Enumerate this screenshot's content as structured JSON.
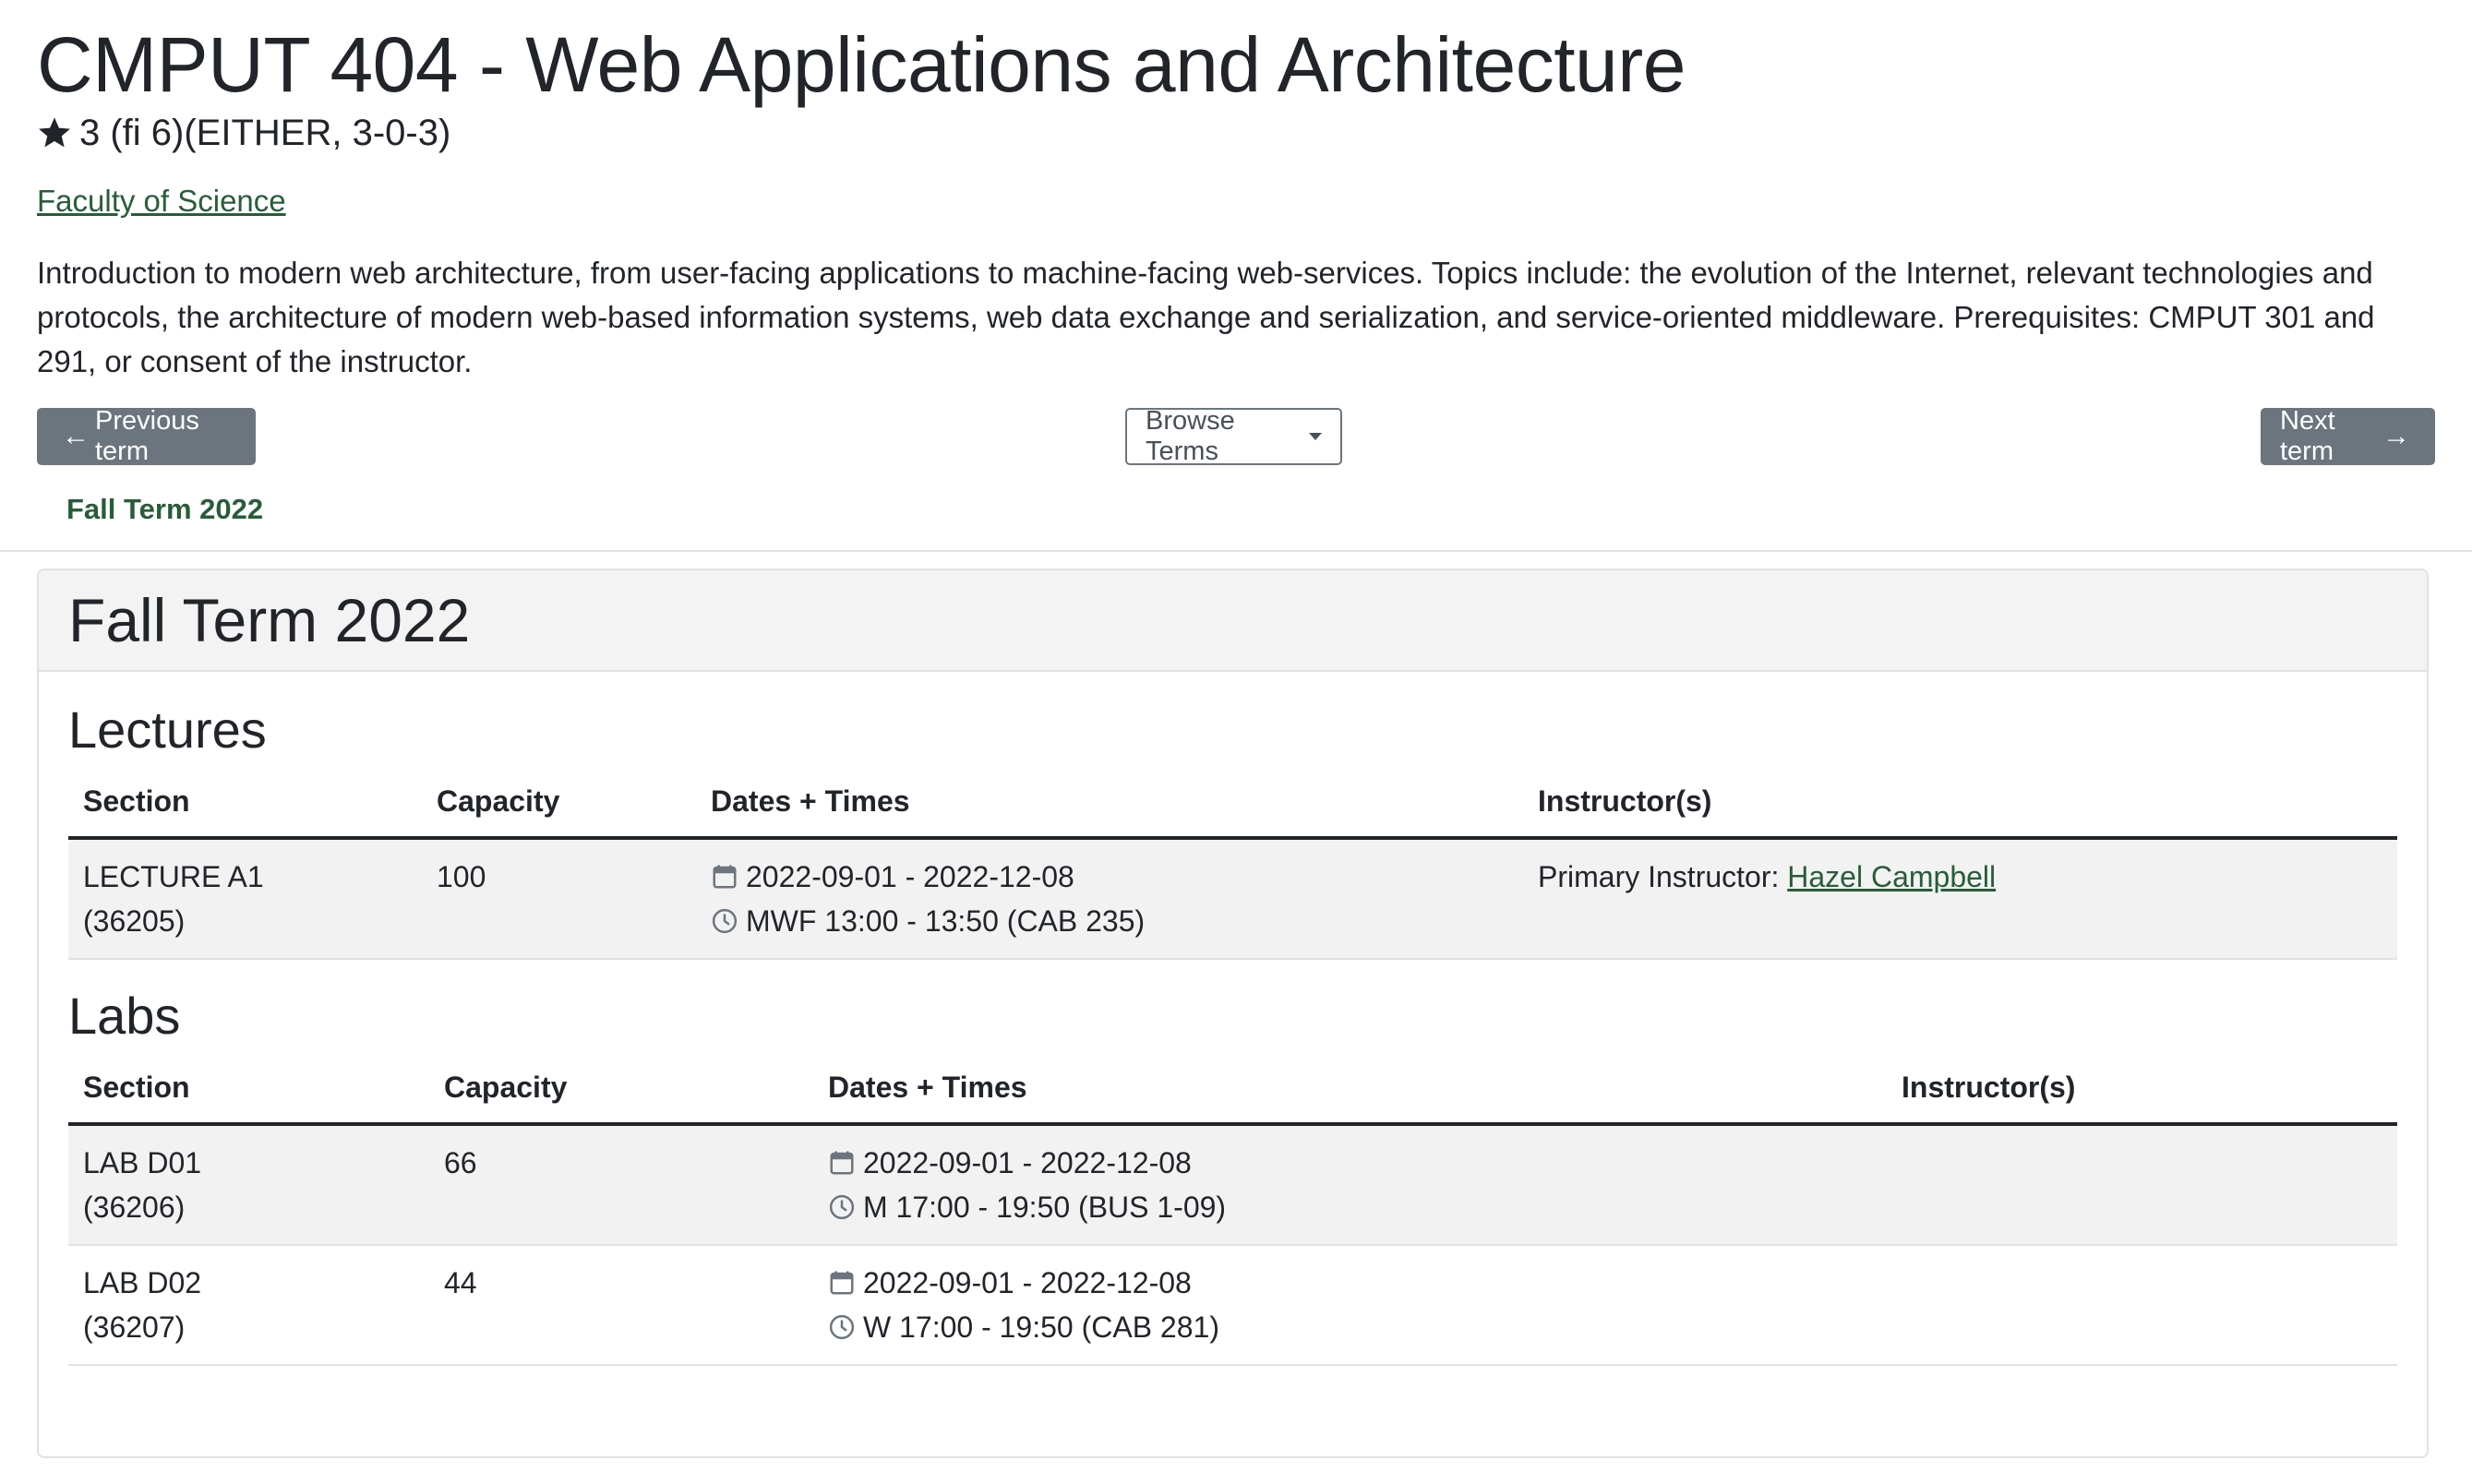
{
  "course": {
    "title": "CMPUT 404 - Web Applications and Architecture",
    "credits": "3 (fi 6)(EITHER, 3-0-3)",
    "faculty": "Faculty of Science",
    "description": "Introduction to modern web architecture, from user-facing applications to machine-facing web-services. Topics include: the evolution of the Internet, relevant technologies and protocols, the architecture of modern web-based information systems, web data exchange and serialization, and service-oriented middleware. Prerequisites: CMPUT 301 and 291, or consent of the instructor."
  },
  "nav": {
    "prev_label": "Previous term",
    "browse_label": "Browse Terms",
    "next_label": "Next term",
    "current_term": "Fall Term 2022"
  },
  "card": {
    "title": "Fall Term 2022"
  },
  "lectures": {
    "heading": "Lectures",
    "columns": [
      "Section",
      "Capacity",
      "Dates + Times",
      "Instructor(s)"
    ],
    "rows": [
      {
        "section": "LECTURE A1",
        "section_id": "(36205)",
        "capacity": "100",
        "dates": "2022-09-01 - 2022-12-08",
        "times": "MWF 13:00 - 13:50 (CAB 235)",
        "instructor_prefix": "Primary Instructor: ",
        "instructor": "Hazel Campbell"
      }
    ]
  },
  "labs": {
    "heading": "Labs",
    "columns": [
      "Section",
      "Capacity",
      "Dates + Times",
      "Instructor(s)"
    ],
    "rows": [
      {
        "section": "LAB D01",
        "section_id": "(36206)",
        "capacity": "66",
        "dates": "2022-09-01 - 2022-12-08",
        "times": "M 17:00 - 19:50 (BUS 1-09)"
      },
      {
        "section": "LAB D02",
        "section_id": "(36207)",
        "capacity": "44",
        "dates": "2022-09-01 - 2022-12-08",
        "times": "W 17:00 - 19:50 (CAB 281)"
      }
    ]
  },
  "colors": {
    "link_green": "#275d38",
    "button_gray": "#6c757d",
    "stripe": "#f2f2f2"
  }
}
